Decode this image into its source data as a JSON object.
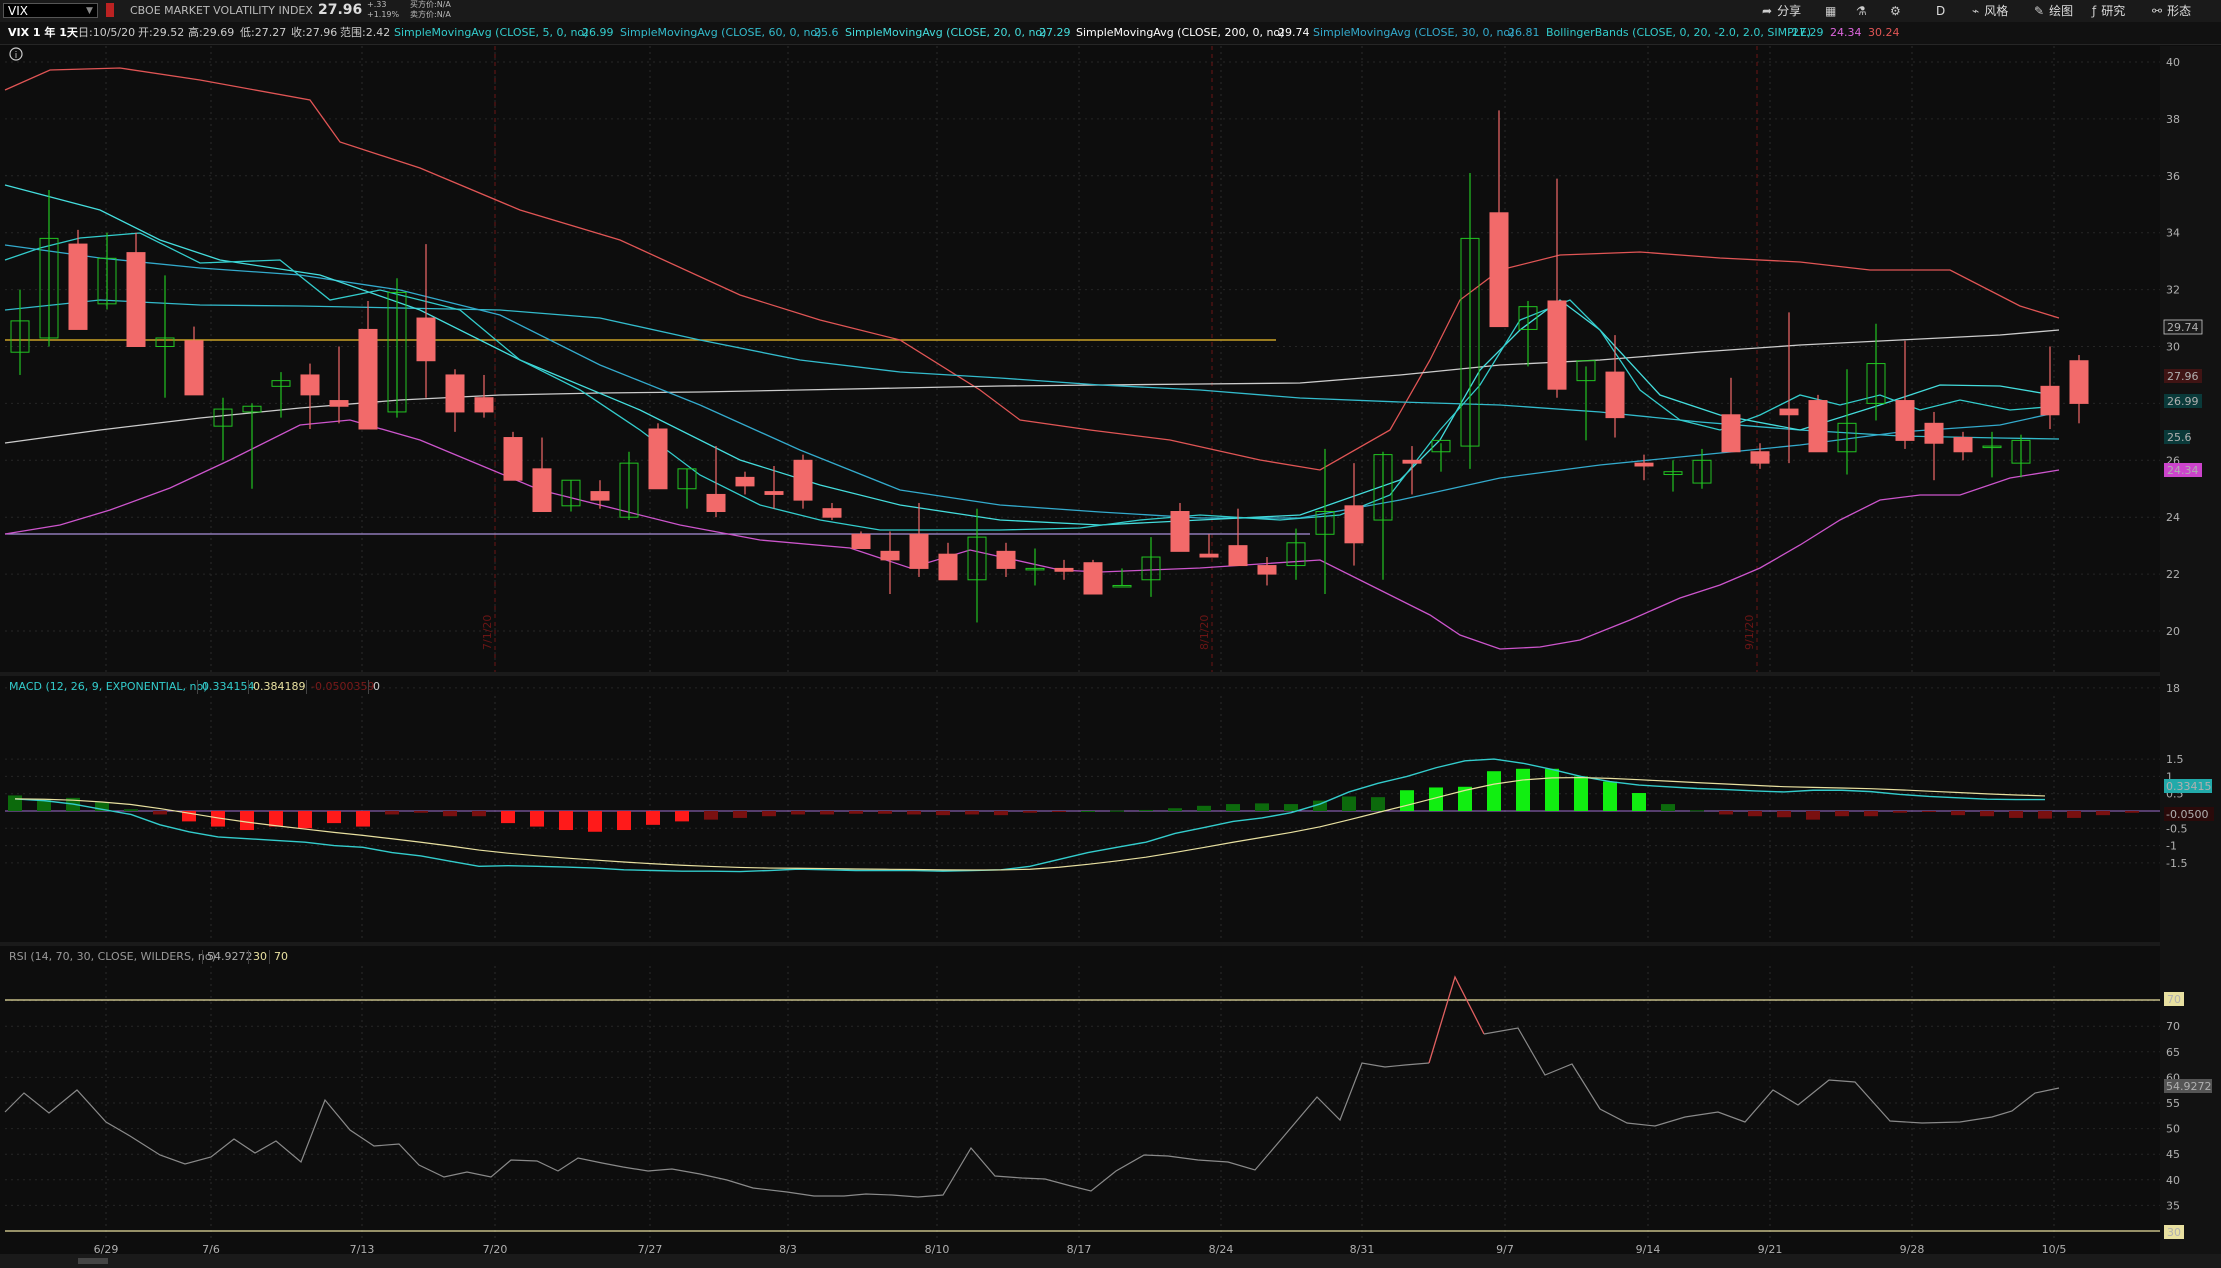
{
  "header": {
    "symbol": "VIX",
    "description": "CBOE MARKET VOLATILITY INDEX",
    "last": "27.96",
    "change": "+.33",
    "change_pct": "+1.19%",
    "bid": "买方价:N/A",
    "ask": "卖方价:N/A"
  },
  "toolbar": {
    "share": "分享",
    "interval": "D",
    "style": "风格",
    "draw": "绘图",
    "studies": "研究",
    "patterns": "形态"
  },
  "colors": {
    "up": "#22c422",
    "down": "#f26a6a",
    "sma5": "#33cccc",
    "sma60": "#33bbcc",
    "sma20": "#44dddd",
    "sma200": "#cccccc",
    "sma30": "#33aacc",
    "bb_upper": "#e05555",
    "bb_lower": "#cc55cc",
    "macd": "#33cccc",
    "signal": "#e8e0a0",
    "rsi": "#888888",
    "rsi_ob": "#e05555"
  },
  "studybar": {
    "title": "VIX 1 年 1天",
    "date": "日:10/5/20",
    "open": "开:29.52",
    "high": "高:29.69",
    "low": "低:27.27",
    "close": "收:27.96",
    "range": "范围:2.42",
    "studies": [
      {
        "label": "SimpleMovingAvg (CLOSE, 5, 0, no)",
        "value": "26.99"
      },
      {
        "label": "SimpleMovingAvg (CLOSE, 60, 0, no)",
        "value": "25.6"
      },
      {
        "label": "SimpleMovingAvg (CLOSE, 20, 0, no)",
        "value": "27.29"
      },
      {
        "label": "SimpleMovingAvg (CLOSE, 200, 0, no)",
        "value": "29.74"
      },
      {
        "label": "SimpleMovingAvg (CLOSE, 30, 0, no)",
        "value": "26.81"
      },
      {
        "label": "BollingerBands (CLOSE, 0, 20, -2.0, 2.0, SIMPLE)",
        "value": "27.29",
        "value2": "24.34",
        "value3": "30.24"
      }
    ]
  },
  "macd": {
    "label": "MACD (12, 26, 9, EXPONENTIAL, no)",
    "v1": "0.334154",
    "v2": "0.384189",
    "v3": "-0.0500359",
    "v4": "0"
  },
  "rsi": {
    "label": "RSI (14, 70, 30, CLOSE, WILDERS, no)",
    "v1": "54.9272",
    "v2": "30",
    "v3": "70"
  },
  "price_tags": {
    "sma200": "29.74",
    "close": "27.96",
    "sma5": "26.99",
    "sma60": "25.6",
    "lower": "24.34",
    "macd": "0.33415",
    "hist": "-0.0500",
    "rsi": "54.9272",
    "rsi70": "70",
    "rsi30": "30"
  },
  "chart_data": {
    "type": "candlestick",
    "x_labels": [
      "6/29",
      "7/6",
      "7/13",
      "7/20",
      "7/27",
      "8/3",
      "8/10",
      "8/17",
      "8/24",
      "8/31",
      "9/7",
      "9/14",
      "9/21",
      "9/28",
      "10/5"
    ],
    "price_ticks": [
      "40",
      "38",
      "36",
      "34",
      "32",
      "30",
      "28",
      "26",
      "24",
      "22",
      "20",
      "18"
    ],
    "macd_ticks": [
      "1.5",
      "1",
      "0.5",
      "0",
      "-0.5",
      "-1",
      "-1.5"
    ],
    "rsi_ticks": [
      "75",
      "70",
      "65",
      "60",
      "55",
      "50",
      "45",
      "40",
      "35",
      "30"
    ],
    "ylim": [
      17,
      40
    ],
    "date_markers": [
      "7/1/20",
      "8/1/20",
      "9/1/20"
    ],
    "candles": [
      [
        29.8,
        32.0,
        29.0,
        30.9
      ],
      [
        30.3,
        35.5,
        30.0,
        33.8
      ],
      [
        33.6,
        34.1,
        30.9,
        30.6
      ],
      [
        31.5,
        34.0,
        31.3,
        33.1
      ],
      [
        33.3,
        34.0,
        31.4,
        30.0
      ],
      [
        30.0,
        32.5,
        28.2,
        30.3
      ],
      [
        30.2,
        30.7,
        29.0,
        28.3
      ],
      [
        27.2,
        28.2,
        26.0,
        27.8
      ],
      [
        27.7,
        28.0,
        25.0,
        27.9
      ],
      [
        28.6,
        29.1,
        27.5,
        28.8
      ],
      [
        29.0,
        29.4,
        27.1,
        28.3
      ],
      [
        28.1,
        30.0,
        27.3,
        27.9
      ],
      [
        30.6,
        31.6,
        27.3,
        27.1
      ],
      [
        27.7,
        32.4,
        27.5,
        31.9
      ],
      [
        31.0,
        33.6,
        28.2,
        29.5
      ],
      [
        29.0,
        29.2,
        27.0,
        27.7
      ],
      [
        28.2,
        29.0,
        27.5,
        27.7
      ],
      [
        26.8,
        27.0,
        25.3,
        25.3
      ],
      [
        25.7,
        26.8,
        24.2,
        24.2
      ],
      [
        24.4,
        25.3,
        24.2,
        25.3
      ],
      [
        24.9,
        25.3,
        24.3,
        24.6
      ],
      [
        24.0,
        26.3,
        23.9,
        25.9
      ],
      [
        27.1,
        27.3,
        25.7,
        25.0
      ],
      [
        25.0,
        25.7,
        24.3,
        25.7
      ],
      [
        24.8,
        26.5,
        24.0,
        24.2
      ],
      [
        25.4,
        25.6,
        24.8,
        25.1
      ],
      [
        24.9,
        25.8,
        24.3,
        24.8
      ],
      [
        26.0,
        26.2,
        24.3,
        24.6
      ],
      [
        24.3,
        24.5,
        23.9,
        24.0
      ],
      [
        23.4,
        23.5,
        22.9,
        22.9
      ],
      [
        22.8,
        23.5,
        21.3,
        22.5
      ],
      [
        23.4,
        24.5,
        21.9,
        22.2
      ],
      [
        22.7,
        23.1,
        22.2,
        21.8
      ],
      [
        21.8,
        24.3,
        20.3,
        23.3
      ],
      [
        22.8,
        23.1,
        21.9,
        22.2
      ],
      [
        22.2,
        22.9,
        21.6,
        22.2
      ],
      [
        22.2,
        22.5,
        21.8,
        22.1
      ],
      [
        22.4,
        22.5,
        21.5,
        21.3
      ],
      [
        21.6,
        22.2,
        21.6,
        21.6
      ],
      [
        21.8,
        23.3,
        21.2,
        22.6
      ],
      [
        24.2,
        24.5,
        22.9,
        22.8
      ],
      [
        22.7,
        23.4,
        22.6,
        22.6
      ],
      [
        23.0,
        24.3,
        22.8,
        22.3
      ],
      [
        22.3,
        22.6,
        21.6,
        22.0
      ],
      [
        22.3,
        23.6,
        21.8,
        23.1
      ],
      [
        23.4,
        26.4,
        21.3,
        24.2
      ],
      [
        24.4,
        25.9,
        22.3,
        23.1
      ],
      [
        23.9,
        26.3,
        21.8,
        26.2
      ],
      [
        26.0,
        26.5,
        24.8,
        25.9
      ],
      [
        26.3,
        26.6,
        25.6,
        26.7
      ],
      [
        26.5,
        36.1,
        25.7,
        33.8
      ],
      [
        34.7,
        38.3,
        31.0,
        30.7
      ],
      [
        30.6,
        31.6,
        29.3,
        31.4
      ],
      [
        31.6,
        35.9,
        28.2,
        28.5
      ],
      [
        28.8,
        29.3,
        26.7,
        29.5
      ],
      [
        29.1,
        30.4,
        26.8,
        27.5
      ],
      [
        25.9,
        26.2,
        25.3,
        25.8
      ],
      [
        25.5,
        26.0,
        24.9,
        25.6
      ],
      [
        25.2,
        26.4,
        25.0,
        26.0
      ],
      [
        27.6,
        28.9,
        26.8,
        26.3
      ],
      [
        26.3,
        26.6,
        25.7,
        25.9
      ],
      [
        27.8,
        31.2,
        25.9,
        27.6
      ],
      [
        28.1,
        28.3,
        27.0,
        26.3
      ],
      [
        26.3,
        29.2,
        25.5,
        27.3
      ],
      [
        28.0,
        30.8,
        27.4,
        29.4
      ],
      [
        28.1,
        30.2,
        26.4,
        26.7
      ],
      [
        27.3,
        27.7,
        25.3,
        26.6
      ],
      [
        26.8,
        27.0,
        26.0,
        26.3
      ],
      [
        26.5,
        27.0,
        25.4,
        26.5
      ],
      [
        25.9,
        26.9,
        25.4,
        26.7
      ],
      [
        28.6,
        30.0,
        27.1,
        27.6
      ],
      [
        29.5,
        29.7,
        27.3,
        28.0
      ]
    ],
    "macd_hist": [
      0.45,
      0.35,
      0.38,
      0.25,
      0.05,
      -0.1,
      -0.3,
      -0.45,
      -0.55,
      -0.45,
      -0.5,
      -0.35,
      -0.45,
      -0.1,
      -0.05,
      -0.15,
      -0.15,
      -0.35,
      -0.45,
      -0.55,
      -0.6,
      -0.55,
      -0.4,
      -0.3,
      -0.25,
      -0.2,
      -0.15,
      -0.1,
      -0.1,
      -0.08,
      -0.08,
      -0.1,
      -0.12,
      -0.1,
      -0.12,
      -0.05,
      -0.02,
      0.0,
      0.01,
      0.03,
      0.08,
      0.15,
      0.2,
      0.22,
      0.2,
      0.3,
      0.42,
      0.4,
      0.6,
      0.68,
      0.7,
      1.15,
      1.22,
      1.22,
      1.0,
      0.85,
      0.52,
      0.2,
      0.02,
      -0.1,
      -0.15,
      -0.18,
      -0.25,
      -0.15,
      -0.15,
      -0.05,
      -0.02,
      -0.12,
      -0.15,
      -0.2,
      -0.22,
      -0.2,
      -0.12,
      -0.05
    ],
    "macd_line": [
      0.35,
      0.3,
      0.2,
      0.05,
      -0.1,
      -0.4,
      -0.6,
      -0.75,
      -0.8,
      -0.85,
      -0.9,
      -1.0,
      -1.05,
      -1.2,
      -1.3,
      -1.45,
      -1.6,
      -1.58,
      -1.6,
      -1.62,
      -1.65,
      -1.7,
      -1.72,
      -1.74,
      -1.74,
      -1.75,
      -1.72,
      -1.68,
      -1.7,
      -1.72,
      -1.72,
      -1.72,
      -1.74,
      -1.72,
      -1.7,
      -1.6,
      -1.4,
      -1.2,
      -1.05,
      -0.9,
      -0.65,
      -0.48,
      -0.3,
      -0.2,
      -0.05,
      0.2,
      0.55,
      0.8,
      1.0,
      1.25,
      1.45,
      1.5,
      1.38,
      1.2,
      1.0,
      0.85,
      0.75,
      0.7,
      0.65,
      0.62,
      0.58,
      0.55,
      0.6,
      0.6,
      0.56,
      0.48,
      0.42,
      0.38,
      0.34,
      0.33,
      0.33
    ]
  },
  "sidebar_right": {
    "rsi_note": ""
  }
}
